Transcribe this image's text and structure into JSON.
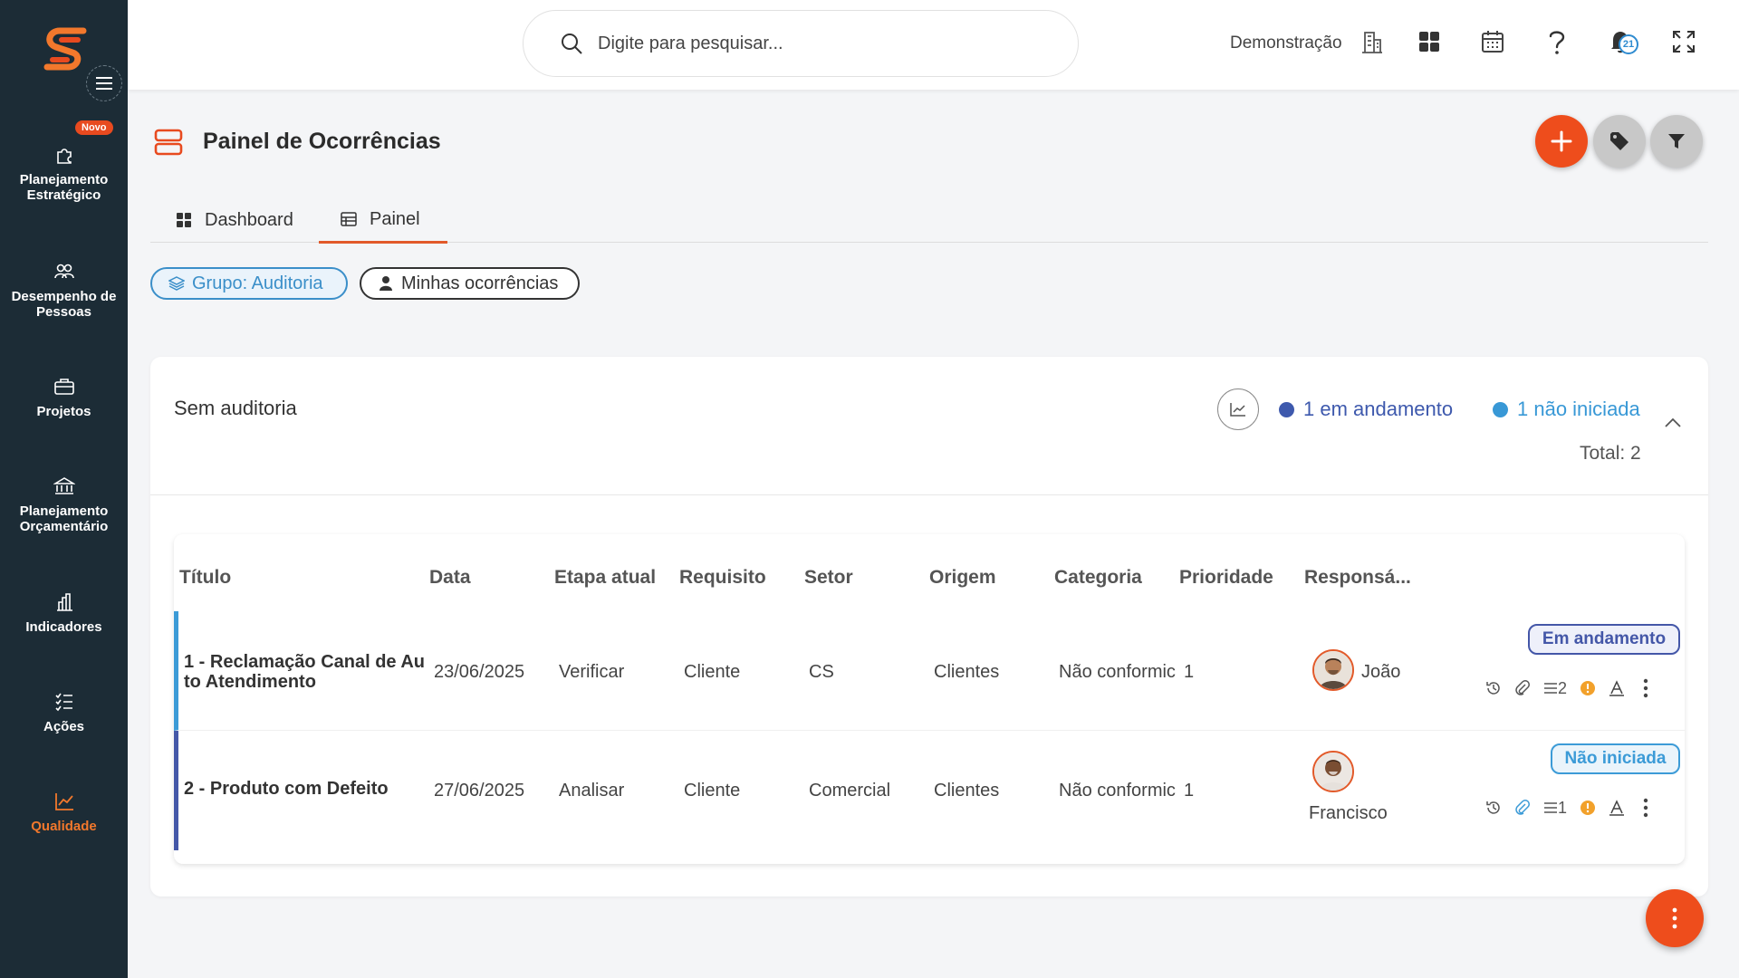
{
  "sidebar": {
    "badge_novo": "Novo",
    "items": [
      {
        "label": "Planejamento Estratégico",
        "icon": "puzzle-icon"
      },
      {
        "label": "Desempenho de Pessoas",
        "icon": "people-icon"
      },
      {
        "label": "Projetos",
        "icon": "briefcase-icon"
      },
      {
        "label": "Planejamento Orçamentário",
        "icon": "bank-icon"
      },
      {
        "label": "Indicadores",
        "icon": "bar-chart-icon"
      },
      {
        "label": "Ações",
        "icon": "checklist-icon"
      },
      {
        "label": "Qualidade",
        "icon": "line-chart-icon",
        "active": true
      }
    ]
  },
  "topbar": {
    "search_placeholder": "Digite para pesquisar...",
    "env_label": "Demonstração",
    "notification_count": "21"
  },
  "header": {
    "title": "Painel de Ocorrências"
  },
  "tabs": [
    {
      "label": "Dashboard"
    },
    {
      "label": "Painel",
      "active": true
    }
  ],
  "filters": {
    "grupo": "Grupo: Auditoria",
    "minhas": "Minhas ocorrências"
  },
  "group": {
    "title": "Sem auditoria",
    "legend_andamento": "1 em andamento",
    "legend_nao_iniciada": "1 não iniciada",
    "total": "Total: 2"
  },
  "table": {
    "columns": [
      "Título",
      "Data",
      "Etapa atual",
      "Requisito",
      "Setor",
      "Origem",
      "Categoria",
      "Prioridade",
      "Responsá..."
    ],
    "rows": [
      {
        "title": "1 - Reclamação Canal de Au to Atendimento",
        "data": "23/06/2025",
        "etapa": "Verificar",
        "requisito": "Cliente",
        "setor": "CS",
        "origem": "Clientes",
        "categoria": "Não conformic",
        "prioridade": "1",
        "responsavel": "João",
        "status": "Em andamento",
        "count": "2"
      },
      {
        "title": "2 - Produto com Defeito",
        "data": "27/06/2025",
        "etapa": "Analisar",
        "requisito": "Cliente",
        "setor": "Comercial",
        "origem": "Clientes",
        "categoria": "Não conformic",
        "prioridade": "1",
        "responsavel": "Francisco",
        "status": "Não iniciada",
        "count": "1"
      }
    ]
  },
  "colors": {
    "brand": "#ee4d1c",
    "sidebar": "#1c2c36",
    "em_andamento": "#4457a8",
    "nao_iniciada": "#3c9bd7"
  }
}
